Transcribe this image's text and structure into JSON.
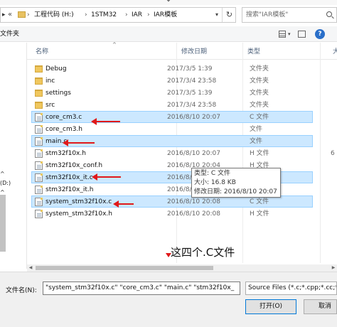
{
  "address_bar": {
    "crumbs": [
      "工程代码 (H:)",
      "1STM32",
      "IAR",
      "IAR模板"
    ],
    "separator": "›",
    "back_chevrons": "«"
  },
  "search": {
    "placeholder": "搜索\"IAR模板\""
  },
  "toolbar": {
    "new_folder_label": "文件夹",
    "help_label": "?"
  },
  "nav_pane": {
    "items": [
      "^",
      "(D:)",
      "^"
    ]
  },
  "columns": {
    "name": "名称",
    "date": "修改日期",
    "type": "类型",
    "size": "大"
  },
  "files": [
    {
      "name": "Debug",
      "date": "2017/3/5 1:39",
      "type": "文件夹",
      "size": "",
      "kind": "folder",
      "selected": false
    },
    {
      "name": "inc",
      "date": "2017/3/4 23:58",
      "type": "文件夹",
      "size": "",
      "kind": "folder",
      "selected": false
    },
    {
      "name": "settings",
      "date": "2017/3/5 1:39",
      "type": "文件夹",
      "size": "",
      "kind": "folder",
      "selected": false
    },
    {
      "name": "src",
      "date": "2017/3/4 23:58",
      "type": "文件夹",
      "size": "",
      "kind": "folder",
      "selected": false
    },
    {
      "name": "core_cm3.c",
      "date": "2016/8/10 20:07",
      "type": "C 文件",
      "size": "",
      "kind": "file",
      "selected": true
    },
    {
      "name": "core_cm3.h",
      "date": "",
      "type": "文件",
      "size": "",
      "kind": "file",
      "selected": false
    },
    {
      "name": "main.c",
      "date": "",
      "type": "文件",
      "size": "",
      "kind": "file",
      "selected": true
    },
    {
      "name": "stm32f10x.h",
      "date": "2016/8/10 20:07",
      "type": "H 文件",
      "size": "6",
      "kind": "file",
      "selected": false
    },
    {
      "name": "stm32f10x_conf.h",
      "date": "2016/8/10 20:04",
      "type": "H 文件",
      "size": "",
      "kind": "file",
      "selected": false
    },
    {
      "name": "stm32f10x_it.c",
      "date": "2016/8/10 20:04",
      "type": "C 文件",
      "size": "",
      "kind": "file",
      "selected": true
    },
    {
      "name": "stm32f10x_it.h",
      "date": "2016/8/10 20:04",
      "type": "H 文件",
      "size": "",
      "kind": "file",
      "selected": false
    },
    {
      "name": "system_stm32f10x.c",
      "date": "2016/8/10 20:08",
      "type": "C 文件",
      "size": "",
      "kind": "file",
      "selected": true
    },
    {
      "name": "system_stm32f10x.h",
      "date": "2016/8/10 20:08",
      "type": "H 文件",
      "size": "",
      "kind": "file",
      "selected": false
    }
  ],
  "tooltip": {
    "type_line": "类型: C 文件",
    "size_line": "大小: 16.8 KB",
    "date_line": "修改日期: 2016/8/10 20:07"
  },
  "annotation": {
    "text": "这四个.C文件",
    "color": "#e0191a"
  },
  "footer": {
    "filename_label": "文件名(N):",
    "filename_value": "\"system_stm32f10x.c\" \"core_cm3.c\" \"main.c\" \"stm32f10x_",
    "filter_value": "Source Files (*.c;*.cpp;*.cc;*",
    "open_label": "打开(O)",
    "cancel_label": "取消"
  },
  "colors": {
    "selection_bg": "#cce8ff",
    "selection_border": "#99d1ff",
    "accent_border": "#0078d7"
  }
}
